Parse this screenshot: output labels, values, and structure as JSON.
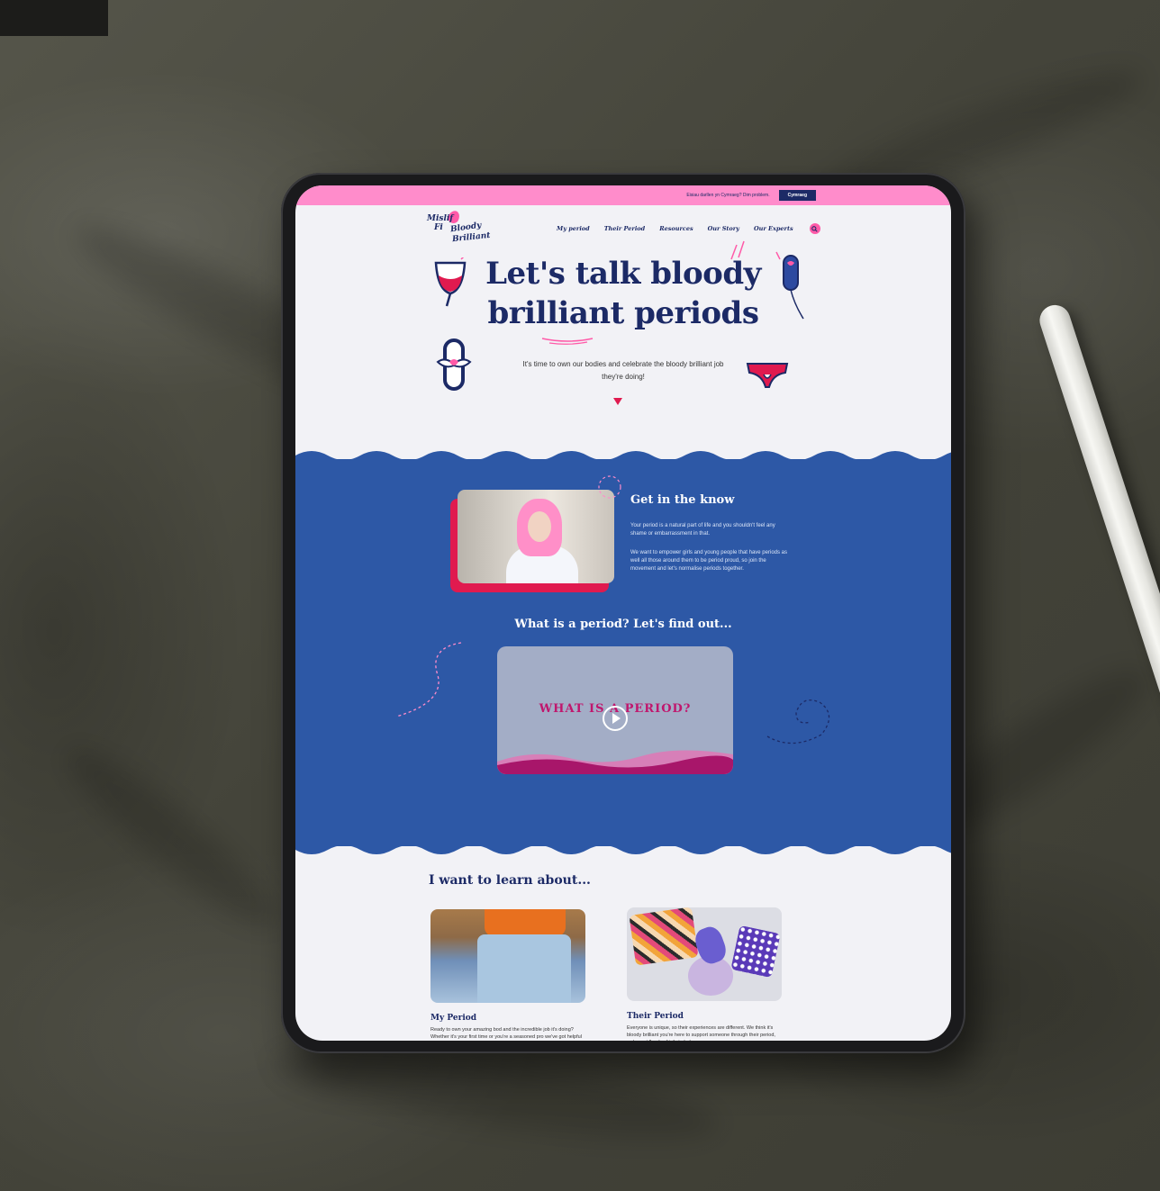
{
  "topbar": {
    "text": "Eisiau darllen yn Cymraeg? Dim problem.",
    "button_label": "Cymraeg"
  },
  "logo": {
    "line1": "Mislif",
    "line2": "Fi",
    "line3": "Bloody",
    "line4": "Brilliant"
  },
  "nav": {
    "items": [
      {
        "label": "My period"
      },
      {
        "label": "Their Period"
      },
      {
        "label": "Resources"
      },
      {
        "label": "Our Story"
      },
      {
        "label": "Our Experts"
      }
    ],
    "search_icon": "search-icon"
  },
  "hero": {
    "title_line1": "Let's talk bloody",
    "title_line2": "brilliant periods",
    "subtitle": "It's time to own our bodies and celebrate the bloody brilliant job they're doing!"
  },
  "know": {
    "title": "Get in the know",
    "p1": "Your period is a natural part of life and you shouldn't feel any shame or embarrassment in that.",
    "p2": "We want to empower girls and young people that have periods as well all those around them to be period proud, so join the movement and let's normalise periods together."
  },
  "video": {
    "section_title": "What is a period? Let's find out...",
    "overlay_text": "WHAT IS A PERIOD?"
  },
  "learn": {
    "title": "I want to learn about...",
    "cards": [
      {
        "title": "My Period",
        "desc": "Ready to own your amazing bod and the incredible job it's doing? Whether it's your first time or you're a seasoned pro we've got helpful tips for everyone."
      },
      {
        "title": "Their Period",
        "desc": "Everyone is unique, so their experiences are different. We think it's bloody brilliant you're here to support someone through their period, we've got floods of info to help you"
      }
    ]
  },
  "colors": {
    "pink_bar": "#ff8ccb",
    "navy": "#1c2a66",
    "blue_section": "#2d58a6",
    "accent_red": "#e01a4f",
    "magenta": "#c0166d"
  }
}
